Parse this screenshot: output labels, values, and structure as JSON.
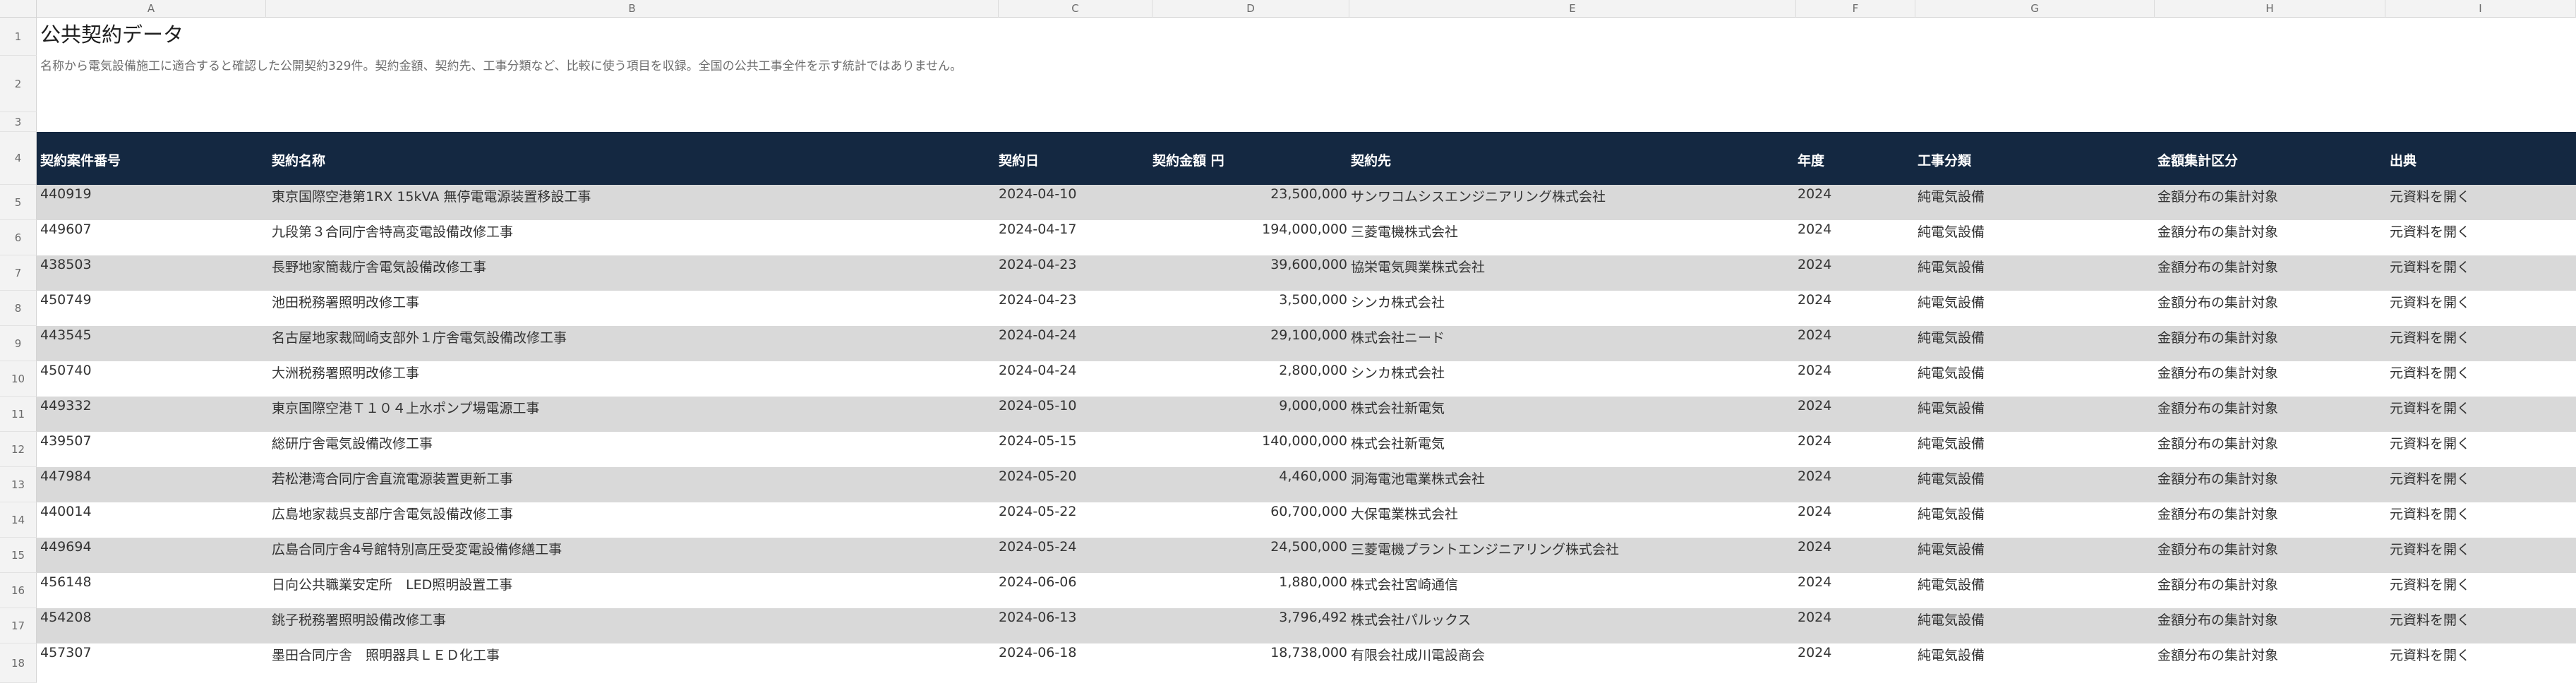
{
  "sheet": {
    "column_letters": [
      "A",
      "B",
      "C",
      "D",
      "E",
      "F",
      "G",
      "H",
      "I"
    ],
    "row_numbers": [
      "1",
      "2",
      "3",
      "4",
      "5",
      "6",
      "7",
      "8",
      "9",
      "10",
      "11",
      "12",
      "13",
      "14",
      "15",
      "16",
      "17",
      "18"
    ],
    "title": "公共契約データ",
    "subtitle": "名称から電気設備施工に適合すると確認した公開契約329件。契約金額、契約先、工事分類など、比較に使う項目を収録。全国の公共工事全件を示す統計ではありません。",
    "headers": [
      "契約案件番号",
      "契約名称",
      "契約日",
      "契約金額 円",
      "契約先",
      "年度",
      "工事分類",
      "金額集計区分",
      "出典"
    ],
    "rows": [
      [
        "440919",
        "東京国際空港第1RX 15kVA 無停電電源装置移設工事",
        "2024-04-10",
        "23,500,000",
        "サンワコムシスエンジニアリング株式会社",
        "2024",
        "純電気設備",
        "金額分布の集計対象",
        "元資料を開く"
      ],
      [
        "449607",
        "九段第３合同庁舎特高変電設備改修工事",
        "2024-04-17",
        "194,000,000",
        "三菱電機株式会社",
        "2024",
        "純電気設備",
        "金額分布の集計対象",
        "元資料を開く"
      ],
      [
        "438503",
        "長野地家簡裁庁舎電気設備改修工事",
        "2024-04-23",
        "39,600,000",
        "協栄電気興業株式会社",
        "2024",
        "純電気設備",
        "金額分布の集計対象",
        "元資料を開く"
      ],
      [
        "450749",
        "池田税務署照明改修工事",
        "2024-04-23",
        "3,500,000",
        "シンカ株式会社",
        "2024",
        "純電気設備",
        "金額分布の集計対象",
        "元資料を開く"
      ],
      [
        "443545",
        "名古屋地家裁岡崎支部外１庁舎電気設備改修工事",
        "2024-04-24",
        "29,100,000",
        "株式会社ニード",
        "2024",
        "純電気設備",
        "金額分布の集計対象",
        "元資料を開く"
      ],
      [
        "450740",
        "大洲税務署照明改修工事",
        "2024-04-24",
        "2,800,000",
        "シンカ株式会社",
        "2024",
        "純電気設備",
        "金額分布の集計対象",
        "元資料を開く"
      ],
      [
        "449332",
        "東京国際空港Ｔ１０４上水ポンプ場電源工事",
        "2024-05-10",
        "9,000,000",
        "株式会社新電気",
        "2024",
        "純電気設備",
        "金額分布の集計対象",
        "元資料を開く"
      ],
      [
        "439507",
        "総研庁舎電気設備改修工事",
        "2024-05-15",
        "140,000,000",
        "株式会社新電気",
        "2024",
        "純電気設備",
        "金額分布の集計対象",
        "元資料を開く"
      ],
      [
        "447984",
        "若松港湾合同庁舎直流電源装置更新工事",
        "2024-05-20",
        "4,460,000",
        "洞海電池電業株式会社",
        "2024",
        "純電気設備",
        "金額分布の集計対象",
        "元資料を開く"
      ],
      [
        "440014",
        "広島地家裁呉支部庁舎電気設備改修工事",
        "2024-05-22",
        "60,700,000",
        "大保電業株式会社",
        "2024",
        "純電気設備",
        "金額分布の集計対象",
        "元資料を開く"
      ],
      [
        "449694",
        "広島合同庁舎4号館特別高圧受変電設備修繕工事",
        "2024-05-24",
        "24,500,000",
        "三菱電機プラントエンジニアリング株式会社",
        "2024",
        "純電気設備",
        "金額分布の集計対象",
        "元資料を開く"
      ],
      [
        "456148",
        "日向公共職業安定所　LED照明設置工事",
        "2024-06-06",
        "1,880,000",
        "株式会社宮崎通信",
        "2024",
        "純電気設備",
        "金額分布の集計対象",
        "元資料を開く"
      ],
      [
        "454208",
        "銚子税務署照明設備改修工事",
        "2024-06-13",
        "3,796,492",
        "株式会社パルックス",
        "2024",
        "純電気設備",
        "金額分布の集計対象",
        "元資料を開く"
      ],
      [
        "457307",
        "墨田合同庁舎　照明器具ＬＥＤ化工事",
        "2024-06-18",
        "18,738,000",
        "有限会社成川電設商会",
        "2024",
        "純電気設備",
        "金額分布の集計対象",
        "元資料を開く"
      ]
    ]
  }
}
